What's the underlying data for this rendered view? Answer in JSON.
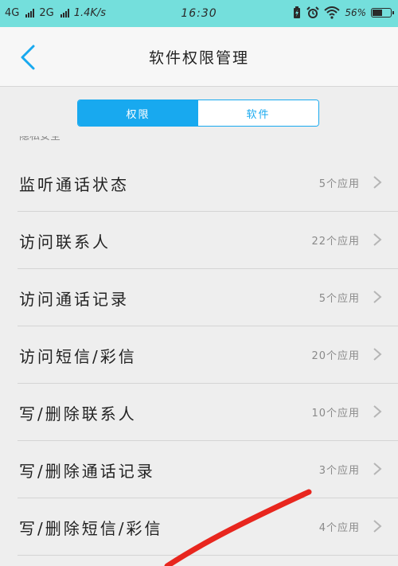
{
  "status_bar": {
    "network1": "4G",
    "network2": "2G",
    "speed": "1.4K/s",
    "time": "16:30",
    "battery": "56%"
  },
  "header": {
    "title": "软件权限管理"
  },
  "segmented": {
    "tabs": [
      {
        "label": "权限",
        "active": true
      },
      {
        "label": "软件",
        "active": false
      }
    ]
  },
  "section": {
    "title": "隐私安全"
  },
  "permissions": [
    {
      "label": "监听通话状态",
      "count": "5个应用"
    },
    {
      "label": "访问联系人",
      "count": "22个应用"
    },
    {
      "label": "访问通话记录",
      "count": "5个应用"
    },
    {
      "label": "访问短信/彩信",
      "count": "20个应用"
    },
    {
      "label": "写/删除联系人",
      "count": "10个应用"
    },
    {
      "label": "写/删除通话记录",
      "count": "3个应用"
    },
    {
      "label": "写/删除短信/彩信",
      "count": "4个应用"
    }
  ],
  "colors": {
    "status_bar": "#74dfdc",
    "accent": "#18a9ef",
    "annotation_stroke": "#e8261e"
  }
}
